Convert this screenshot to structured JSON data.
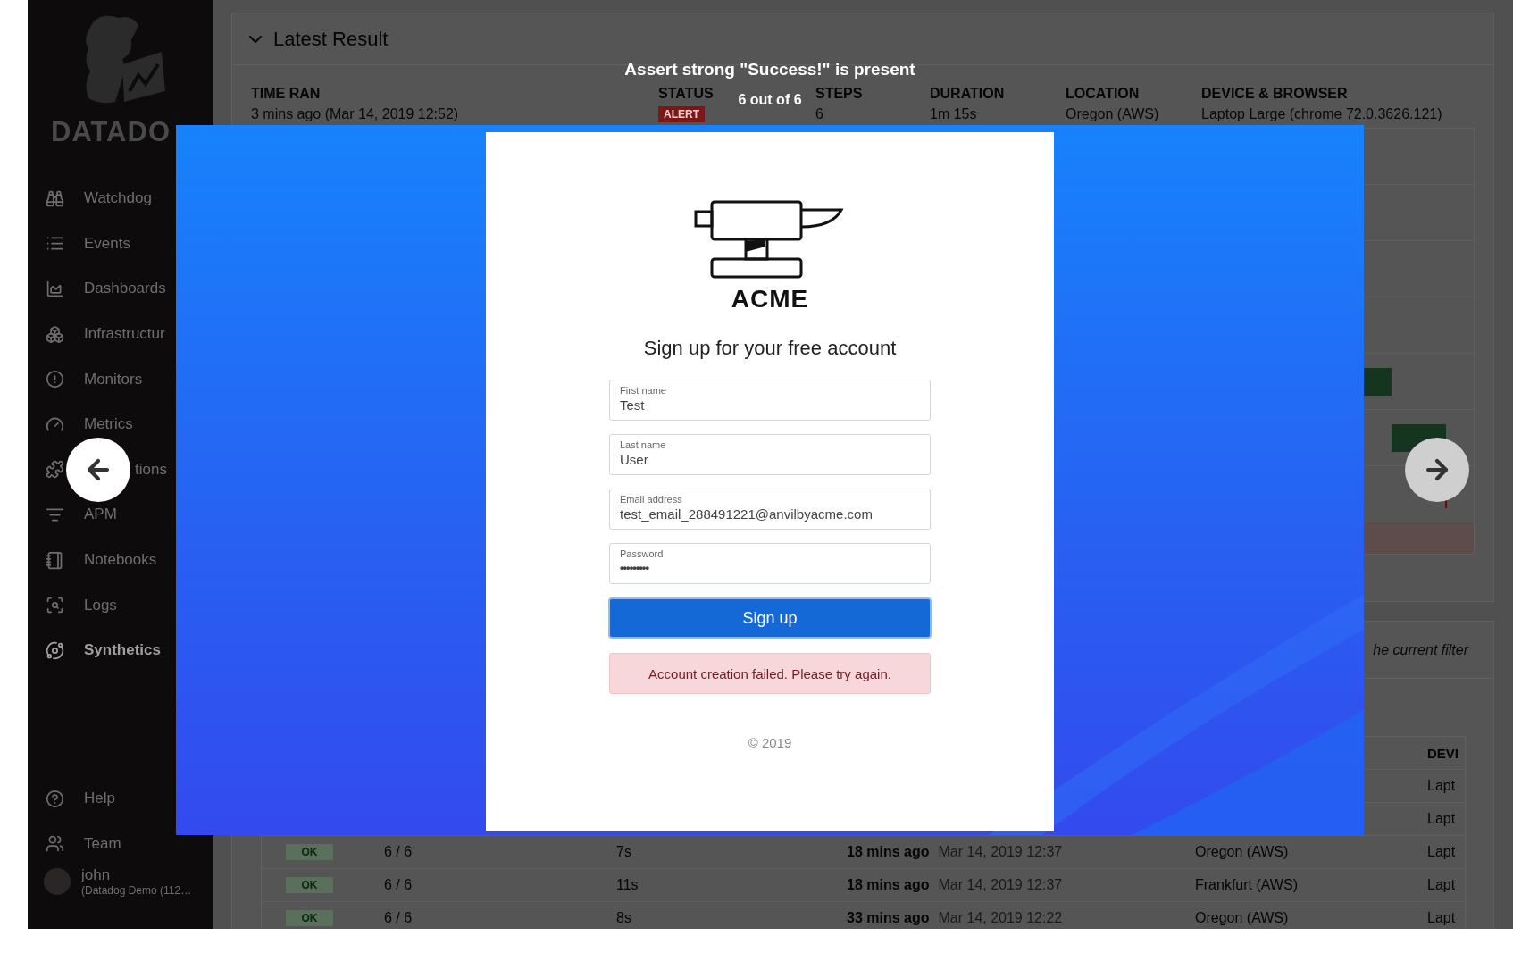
{
  "sidebar": {
    "logo_text": "DATADO",
    "items": [
      {
        "label": "Watchdog",
        "selected": false
      },
      {
        "label": "Events",
        "selected": false
      },
      {
        "label": "Dashboards",
        "selected": false
      },
      {
        "label": "Infrastructur",
        "selected": false
      },
      {
        "label": "Monitors",
        "selected": false
      },
      {
        "label": "Metrics",
        "selected": false
      },
      {
        "label": "tions",
        "selected": false,
        "kind": "obscured"
      },
      {
        "label": "APM",
        "selected": false
      },
      {
        "label": "Notebooks",
        "selected": false
      },
      {
        "label": "Logs",
        "selected": false
      },
      {
        "label": "Synthetics",
        "selected": true
      }
    ],
    "footer_items": [
      {
        "label": "Help"
      },
      {
        "label": "Team"
      }
    ],
    "user": {
      "name": "john",
      "org": "(Datadog Demo (112…"
    }
  },
  "latest_result": {
    "title": "Latest Result",
    "expanded": true,
    "columns": [
      "TIME RAN",
      "STATUS",
      "STEPS",
      "DURATION",
      "LOCATION",
      "DEVICE & BROWSER"
    ],
    "row": {
      "time": "3 mins ago (Mar 14, 2019 12:52)",
      "status": "ALERT",
      "color": "#7a1818",
      "steps": "6",
      "duration": "1m 15s",
      "location": "Oregon (AWS)",
      "device": "Laptop Large (chrome 72.0.3626.121)"
    }
  },
  "filter_note": "he current filter",
  "results_table": {
    "columns": [
      "DEVI"
    ],
    "rows": [
      {
        "device": "Lapt"
      },
      {
        "device": "Lapt"
      },
      {
        "status": "OK",
        "color": "#5b6f5d",
        "steps": "6 / 6",
        "duration": "7s",
        "ago": "18 mins ago",
        "date": "Mar 14, 2019 12:37",
        "location": "Oregon (AWS)",
        "device": "Lapt"
      },
      {
        "status": "OK",
        "color": "#5b6f5d",
        "steps": "6 / 6",
        "duration": "11s",
        "ago": "18 mins ago",
        "date": "Mar 14, 2019 12:37",
        "location": "Frankfurt (AWS)",
        "device": "Lapt"
      },
      {
        "status": "OK",
        "color": "#5b6f5d",
        "steps": "6 / 6",
        "duration": "8s",
        "ago": "33 mins ago",
        "date": "Mar 14, 2019 12:22",
        "location": "Oregon (AWS)",
        "device": "Lapt"
      }
    ]
  },
  "viewer": {
    "caption": "Assert strong \"Success!\" is present",
    "counter": "6 out of 6",
    "page": {
      "logo_text": "ACME",
      "heading": "Sign up for your free account",
      "fields": [
        {
          "label": "First name",
          "value": "Test",
          "kind": "text"
        },
        {
          "label": "Last name",
          "value": "User",
          "kind": "text"
        },
        {
          "label": "Email address",
          "value": "test_email_288491221@anvilbyacme.com",
          "kind": "text"
        },
        {
          "label": "Password",
          "value": "•••••••••",
          "kind": "password"
        }
      ],
      "button": "Sign up",
      "alert": "Account creation failed. Please try again.",
      "footer": "© 2019"
    }
  }
}
